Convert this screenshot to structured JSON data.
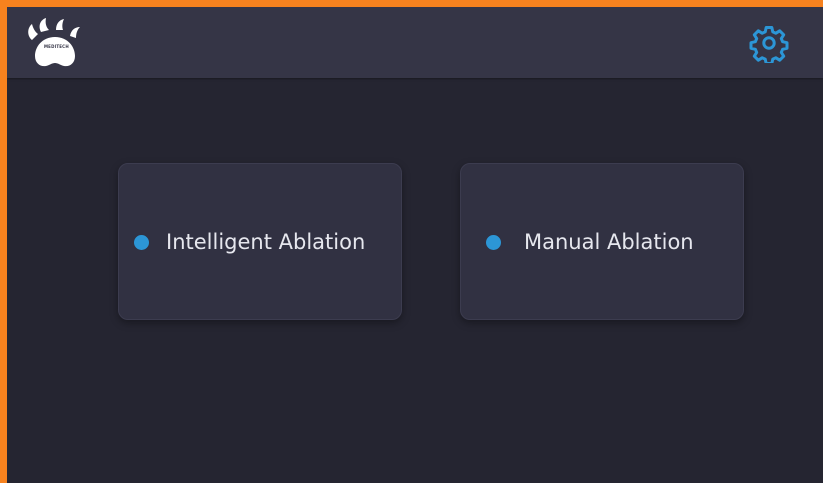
{
  "header": {
    "logo_text": "MEDITECH",
    "settings_icon": "gear-icon"
  },
  "modes": [
    {
      "label": "Intelligent Ablation",
      "indicator_color": "#2c96d6"
    },
    {
      "label": "Manual Ablation",
      "indicator_color": "#2c96d6"
    }
  ],
  "colors": {
    "frame": "#f7821e",
    "background": "#252531",
    "topbar": "#353546",
    "card": "#313142",
    "accent": "#2c96d6",
    "text": "#e6e7ee"
  }
}
